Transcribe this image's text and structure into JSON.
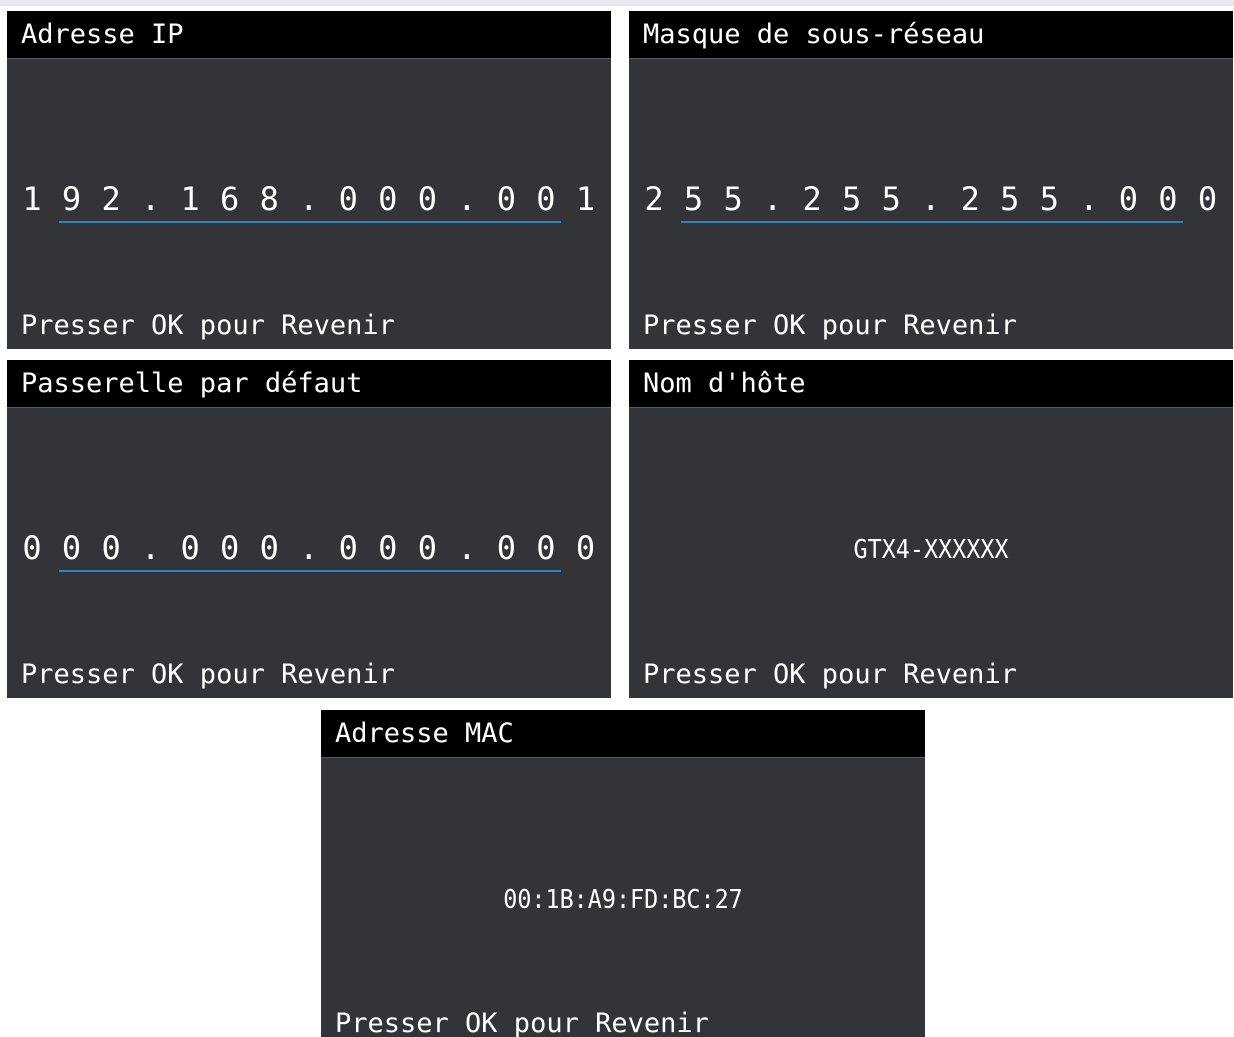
{
  "screens": [
    {
      "title": "Adresse IP",
      "value": "1 9 2 . 1 6 8 . 0 0 0 . 0 0 1",
      "footer": "Presser OK pour Revenir"
    },
    {
      "title": "Masque de sous-réseau",
      "value": "2 5 5 . 2 5 5 . 2 5 5 . 0 0 0",
      "footer": "Presser OK pour Revenir"
    },
    {
      "title": "Passerelle par défaut",
      "value": "0 0 0 . 0 0 0 . 0 0 0 . 0 0 0",
      "footer": "Presser OK pour Revenir"
    },
    {
      "title": "Nom d'hôte",
      "value": "GTX4-XXXXXX",
      "footer": "Presser OK pour Revenir"
    },
    {
      "title": "Adresse MAC",
      "value": "00:1B:A9:FD:BC:27",
      "footer": "Presser OK pour Revenir"
    }
  ],
  "colors": {
    "screen_background": "#333438",
    "header_background": "#000000",
    "text": "#ffffff",
    "field_underline": "#2b85b8"
  }
}
